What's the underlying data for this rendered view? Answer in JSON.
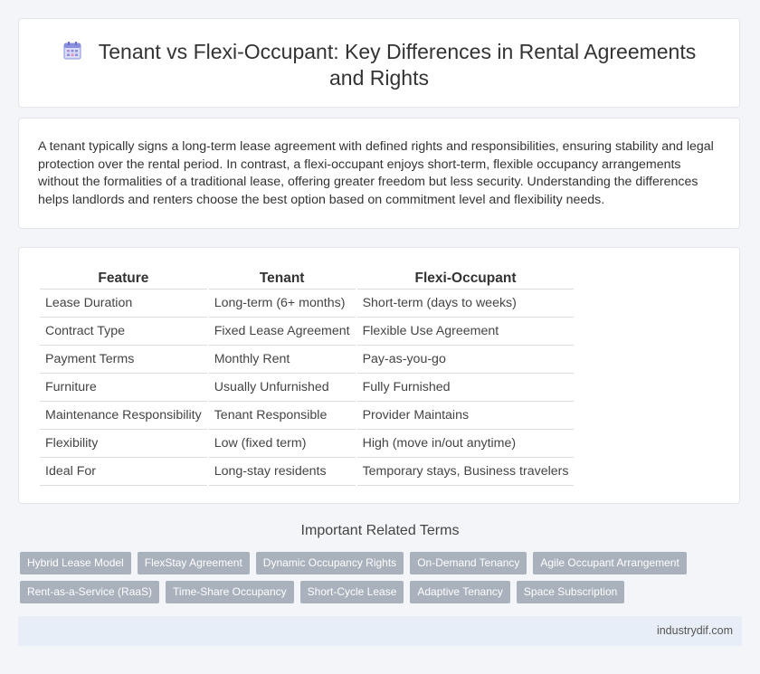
{
  "header": {
    "title": "Tenant vs Flexi-Occupant: Key Differences in Rental Agreements and Rights",
    "icon": "calendar-icon"
  },
  "intro": {
    "text": "A tenant typically signs a long-term lease agreement with defined rights and responsibilities, ensuring stability and legal protection over the rental period. In contrast, a flexi-occupant enjoys short-term, flexible occupancy arrangements without the formalities of a traditional lease, offering greater freedom but less security. Understanding the differences helps landlords and renters choose the best option based on commitment level and flexibility needs."
  },
  "table": {
    "headers": [
      "Feature",
      "Tenant",
      "Flexi-Occupant"
    ],
    "rows": [
      [
        "Lease Duration",
        "Long-term (6+ months)",
        "Short-term (days to weeks)"
      ],
      [
        "Contract Type",
        "Fixed Lease Agreement",
        "Flexible Use Agreement"
      ],
      [
        "Payment Terms",
        "Monthly Rent",
        "Pay-as-you-go"
      ],
      [
        "Furniture",
        "Usually Unfurnished",
        "Fully Furnished"
      ],
      [
        "Maintenance Responsibility",
        "Tenant Responsible",
        "Provider Maintains"
      ],
      [
        "Flexibility",
        "Low (fixed term)",
        "High (move in/out anytime)"
      ],
      [
        "Ideal For",
        "Long-stay residents",
        "Temporary stays, Business travelers"
      ]
    ]
  },
  "related": {
    "title": "Important Related Terms",
    "tags": [
      [
        "Hybrid Lease Model",
        "FlexStay Agreement",
        "Dynamic Occupancy Rights",
        "On-Demand Tenancy",
        "Agile Occupant Arrangement"
      ],
      [
        "Rent-as-a-Service (RaaS)",
        "Time-Share Occupancy",
        "Short-Cycle Lease",
        "Adaptive Tenancy",
        "Space Subscription"
      ]
    ]
  },
  "footer": {
    "site": "industrydif.com"
  },
  "colors": {
    "tag_bg": "#a9b1bd",
    "footer_bg": "#e8eef7",
    "icon_accent": "#8a8fe0"
  }
}
